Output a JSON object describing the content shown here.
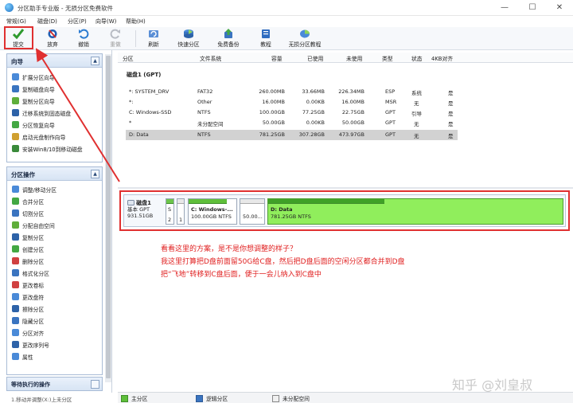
{
  "window": {
    "title": "分区助手专业版 - 无损分区免费软件",
    "min": "—",
    "max": "☐",
    "close": "✕"
  },
  "menu": [
    "常规(G)",
    "磁盘(D)",
    "分区(P)",
    "向导(W)",
    "帮助(H)"
  ],
  "toolbar": {
    "submit": "提交",
    "discard": "放弃",
    "undo": "撤销",
    "redo": "重做",
    "refresh": "刷新",
    "quick_partition": "快速分区",
    "free_backup": "免费备份",
    "tutorial": "教程",
    "lossless_tutorial": "无损分区教程"
  },
  "sidebar": {
    "wizard_title": "向导",
    "wizard_items": [
      "扩展分区向导",
      "复制磁盘向导",
      "复制分区向导",
      "迁移系统到固态磁盘",
      "分区恢复向导",
      "启动光盘制作向导",
      "安装Win8/10到移动磁盘"
    ],
    "ops_title": "分区操作",
    "ops_items": [
      "调整/移动分区",
      "合并分区",
      "切割分区",
      "分配自由空间",
      "复制分区",
      "创建分区",
      "删除分区",
      "格式化分区",
      "更改卷标",
      "更改盘符",
      "擦除分区",
      "隐藏分区",
      "分区对齐",
      "更改序列号",
      "属性"
    ],
    "pending_title": "等待执行的操作",
    "pending_text": "1.移动并调整(X:)上未分区"
  },
  "table": {
    "headers": [
      "分区",
      "文件系统",
      "容量",
      "已使用",
      "未使用",
      "类型",
      "状态",
      "4KB对齐"
    ],
    "disk_label": "磁盘1 (GPT)",
    "rows": [
      {
        "name": "*: SYSTEM_DRV",
        "fs": "FAT32",
        "cap": "260.00MB",
        "used": "33.66MB",
        "free": "226.34MB",
        "type": "ESP",
        "status": "系统",
        "align": "是"
      },
      {
        "name": "*:",
        "fs": "Other",
        "cap": "16.00MB",
        "used": "0.00KB",
        "free": "16.00MB",
        "type": "MSR",
        "status": "无",
        "align": "是"
      },
      {
        "name": "C: Windows-SSD",
        "fs": "NTFS",
        "cap": "100.00GB",
        "used": "77.25GB",
        "free": "22.75GB",
        "type": "GPT",
        "status": "引导",
        "align": "是"
      },
      {
        "name": "*",
        "fs": "未分配空间",
        "cap": "50.00GB",
        "used": "0.00KB",
        "free": "50.00GB",
        "type": "GPT",
        "status": "无",
        "align": "是"
      },
      {
        "name": "D: Data",
        "fs": "NTFS",
        "cap": "781.25GB",
        "used": "307.28GB",
        "free": "473.97GB",
        "type": "GPT",
        "status": "无",
        "align": "是"
      }
    ]
  },
  "diskmap": {
    "disk_name": "磁盘1",
    "disk_type": "基本 GPT",
    "disk_size": "931.51GB",
    "p1_label": "S",
    "p1_num": "2",
    "p2_num": "1",
    "c_label": "C: Windows-...",
    "c_size": "100.00GB NTFS",
    "unalloc_size": "50.00...",
    "d_label": "D: Data",
    "d_size": "781.25GB NTFS"
  },
  "annotation": {
    "line1": "看看这里的方案，是不是你想调整的样子？",
    "line2": "我这里打算把D盘前面留50G给C盘，然后把D盘后面的空闲分区都合并到D盘",
    "line3": "把“飞地”转移到C盘后面，便于一会儿纳入到C盘中"
  },
  "watermark": "知乎 @刘皇叔",
  "legend": {
    "primary": "主分区",
    "logical": "逻辑分区",
    "unallocated": "未分配空间"
  },
  "colors": {
    "accent_red": "#e03030",
    "partition_green": "#90ee5c",
    "used_bar_green": "#3fa127"
  }
}
